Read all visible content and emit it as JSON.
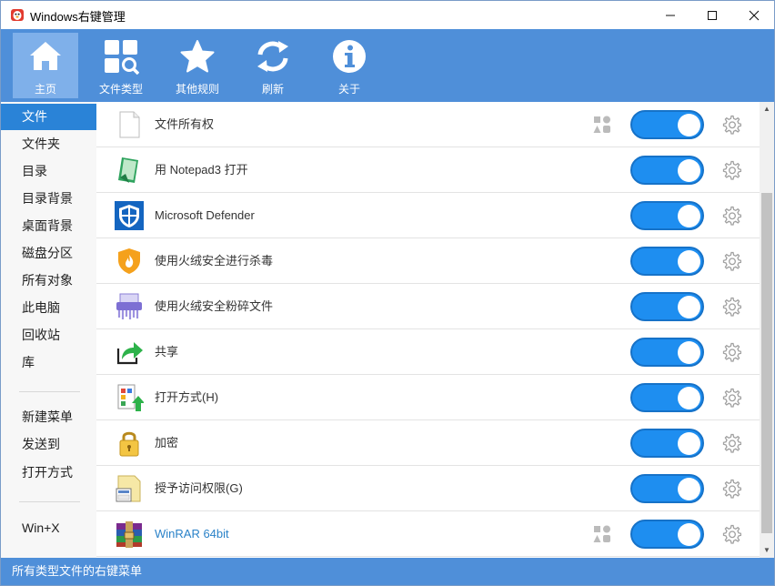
{
  "window": {
    "title": "Windows右键管理",
    "minimize": "—",
    "maximize": "☐",
    "close": "✕"
  },
  "toolbar": {
    "items": [
      {
        "label": "主页",
        "icon": "home-icon",
        "active": true
      },
      {
        "label": "文件类型",
        "icon": "file-type-search-icon"
      },
      {
        "label": "其他规则",
        "icon": "star-icon"
      },
      {
        "label": "刷新",
        "icon": "refresh-icon"
      },
      {
        "label": "关于",
        "icon": "info-icon"
      }
    ]
  },
  "sidebar": {
    "items": [
      {
        "label": "文件",
        "active": true
      },
      {
        "label": "文件夹"
      },
      {
        "label": "目录"
      },
      {
        "label": "目录背景"
      },
      {
        "label": "桌面背景"
      },
      {
        "label": "磁盘分区"
      },
      {
        "label": "所有对象"
      },
      {
        "label": "此电脑"
      },
      {
        "label": "回收站"
      },
      {
        "label": "库"
      }
    ],
    "group2": [
      {
        "label": "新建菜单"
      },
      {
        "label": "发送到"
      },
      {
        "label": "打开方式"
      }
    ],
    "group3": [
      {
        "label": "Win+X"
      }
    ]
  },
  "list": {
    "rows": [
      {
        "label": "文件所有权",
        "icon": "blank-file-icon",
        "enabled": true,
        "multi": true
      },
      {
        "label": "用 Notepad3 打开",
        "icon": "notepad3-icon",
        "enabled": true
      },
      {
        "label": "Microsoft Defender",
        "icon": "defender-shield-icon",
        "enabled": true
      },
      {
        "label": "使用火绒安全进行杀毒",
        "icon": "huorong-shield-icon",
        "enabled": true
      },
      {
        "label": "使用火绒安全粉碎文件",
        "icon": "shredder-icon",
        "enabled": true
      },
      {
        "label": "共享",
        "icon": "share-arrow-icon",
        "enabled": true
      },
      {
        "label": "打开方式(H)",
        "icon": "open-with-icon",
        "enabled": true
      },
      {
        "label": "加密",
        "icon": "lock-icon",
        "enabled": true
      },
      {
        "label": "授予访问权限(G)",
        "icon": "grant-access-icon",
        "enabled": true
      },
      {
        "label": "WinRAR 64bit",
        "icon": "winrar-icon",
        "enabled": true,
        "multi": true,
        "link": true
      }
    ]
  },
  "status": {
    "text": "所有类型文件的右键菜单"
  },
  "colors": {
    "accent": "#4f8fd9",
    "toggle_on": "#1e8ef0",
    "sidebar_active": "#2a83d7"
  }
}
